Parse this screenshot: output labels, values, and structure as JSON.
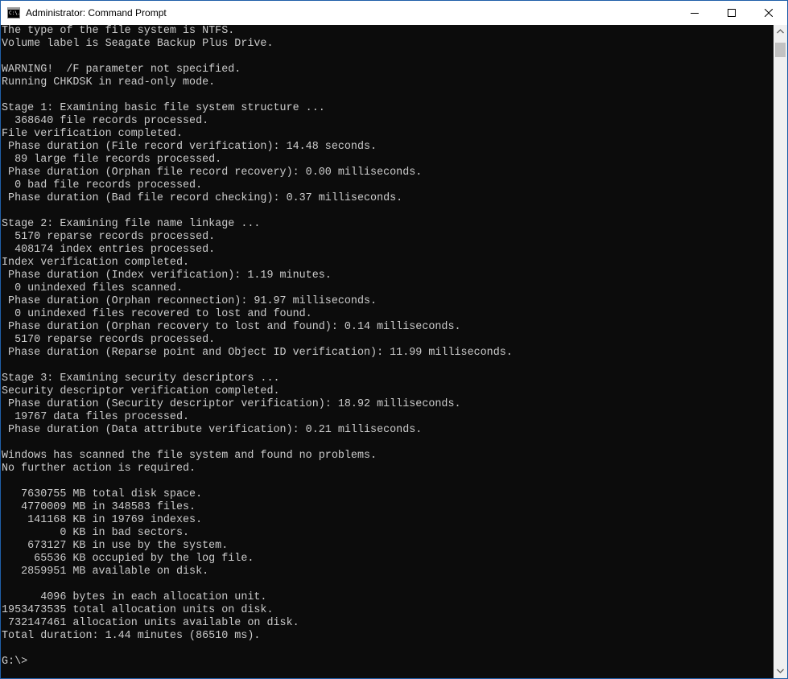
{
  "window": {
    "title": "Administrator: Command Prompt",
    "icon_label": "C:\\."
  },
  "console": {
    "lines": [
      "The type of the file system is NTFS.",
      "Volume label is Seagate Backup Plus Drive.",
      "",
      "WARNING!  /F parameter not specified.",
      "Running CHKDSK in read-only mode.",
      "",
      "Stage 1: Examining basic file system structure ...",
      "  368640 file records processed.",
      "File verification completed.",
      " Phase duration (File record verification): 14.48 seconds.",
      "  89 large file records processed.",
      " Phase duration (Orphan file record recovery): 0.00 milliseconds.",
      "  0 bad file records processed.",
      " Phase duration (Bad file record checking): 0.37 milliseconds.",
      "",
      "Stage 2: Examining file name linkage ...",
      "  5170 reparse records processed.",
      "  408174 index entries processed.",
      "Index verification completed.",
      " Phase duration (Index verification): 1.19 minutes.",
      "  0 unindexed files scanned.",
      " Phase duration (Orphan reconnection): 91.97 milliseconds.",
      "  0 unindexed files recovered to lost and found.",
      " Phase duration (Orphan recovery to lost and found): 0.14 milliseconds.",
      "  5170 reparse records processed.",
      " Phase duration (Reparse point and Object ID verification): 11.99 milliseconds.",
      "",
      "Stage 3: Examining security descriptors ...",
      "Security descriptor verification completed.",
      " Phase duration (Security descriptor verification): 18.92 milliseconds.",
      "  19767 data files processed.",
      " Phase duration (Data attribute verification): 0.21 milliseconds.",
      "",
      "Windows has scanned the file system and found no problems.",
      "No further action is required.",
      "",
      "   7630755 MB total disk space.",
      "   4770009 MB in 348583 files.",
      "    141168 KB in 19769 indexes.",
      "         0 KB in bad sectors.",
      "    673127 KB in use by the system.",
      "     65536 KB occupied by the log file.",
      "   2859951 MB available on disk.",
      "",
      "      4096 bytes in each allocation unit.",
      "1953473535 total allocation units on disk.",
      " 732147461 allocation units available on disk.",
      "Total duration: 1.44 minutes (86510 ms).",
      "",
      "G:\\>"
    ]
  },
  "icons": {
    "minimize": "minimize-icon",
    "maximize": "maximize-icon",
    "close": "close-icon",
    "scroll_up": "chevron-up-icon",
    "scroll_down": "chevron-down-icon"
  }
}
